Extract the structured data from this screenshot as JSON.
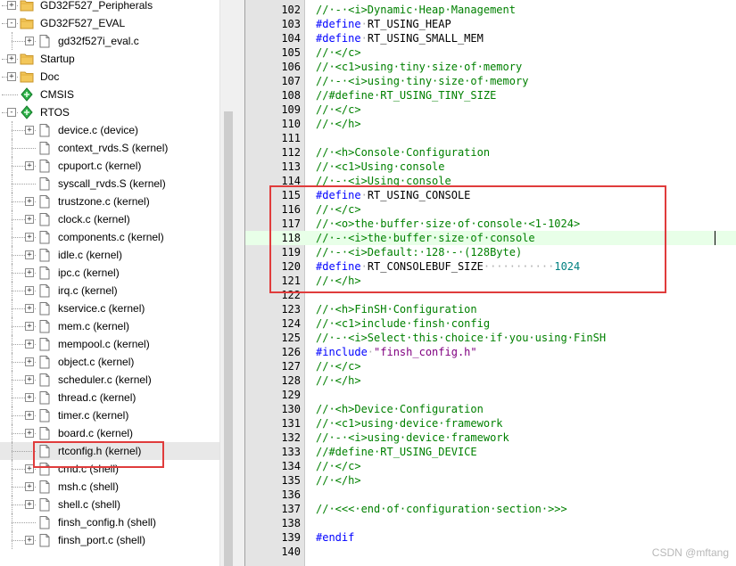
{
  "project_tree": {
    "items": [
      {
        "label": "GD32F527_Peripherals",
        "type": "folder",
        "state": "+",
        "level": 1
      },
      {
        "label": "GD32F527_EVAL",
        "type": "folder",
        "state": "-",
        "level": 1
      },
      {
        "label": "gd32f527i_eval.c",
        "type": "file",
        "state": "+",
        "level": 2
      },
      {
        "label": "Startup",
        "type": "folder",
        "state": "+",
        "level": 1
      },
      {
        "label": "Doc",
        "type": "folder",
        "state": "+",
        "level": 1
      },
      {
        "label": "CMSIS",
        "type": "component",
        "state": "",
        "level": 1
      },
      {
        "label": "RTOS",
        "type": "component",
        "state": "-",
        "level": 1
      },
      {
        "label": "device.c (device)",
        "type": "file",
        "state": "+",
        "level": 2
      },
      {
        "label": "context_rvds.S (kernel)",
        "type": "file",
        "state": "",
        "level": 2
      },
      {
        "label": "cpuport.c (kernel)",
        "type": "file",
        "state": "+",
        "level": 2
      },
      {
        "label": "syscall_rvds.S (kernel)",
        "type": "file",
        "state": "",
        "level": 2
      },
      {
        "label": "trustzone.c (kernel)",
        "type": "file",
        "state": "+",
        "level": 2
      },
      {
        "label": "clock.c (kernel)",
        "type": "file",
        "state": "+",
        "level": 2
      },
      {
        "label": "components.c (kernel)",
        "type": "file",
        "state": "+",
        "level": 2
      },
      {
        "label": "idle.c (kernel)",
        "type": "file",
        "state": "+",
        "level": 2
      },
      {
        "label": "ipc.c (kernel)",
        "type": "file",
        "state": "+",
        "level": 2
      },
      {
        "label": "irq.c (kernel)",
        "type": "file",
        "state": "+",
        "level": 2
      },
      {
        "label": "kservice.c (kernel)",
        "type": "file",
        "state": "+",
        "level": 2
      },
      {
        "label": "mem.c (kernel)",
        "type": "file",
        "state": "+",
        "level": 2
      },
      {
        "label": "mempool.c (kernel)",
        "type": "file",
        "state": "+",
        "level": 2
      },
      {
        "label": "object.c (kernel)",
        "type": "file",
        "state": "+",
        "level": 2
      },
      {
        "label": "scheduler.c (kernel)",
        "type": "file",
        "state": "+",
        "level": 2
      },
      {
        "label": "thread.c (kernel)",
        "type": "file",
        "state": "+",
        "level": 2
      },
      {
        "label": "timer.c (kernel)",
        "type": "file",
        "state": "+",
        "level": 2
      },
      {
        "label": "board.c (kernel)",
        "type": "file",
        "state": "+",
        "level": 2
      },
      {
        "label": "rtconfig.h (kernel)",
        "type": "file",
        "state": "",
        "level": 2,
        "selected": true
      },
      {
        "label": "cmd.c (shell)",
        "type": "file",
        "state": "+",
        "level": 2
      },
      {
        "label": "msh.c (shell)",
        "type": "file",
        "state": "+",
        "level": 2
      },
      {
        "label": "shell.c (shell)",
        "type": "file",
        "state": "+",
        "level": 2
      },
      {
        "label": "finsh_config.h (shell)",
        "type": "file",
        "state": "",
        "level": 2
      },
      {
        "label": "finsh_port.c (shell)",
        "type": "file",
        "state": "+",
        "level": 2
      }
    ]
  },
  "editor": {
    "current_line": 118,
    "lines": [
      {
        "n": "102",
        "tokens": [
          [
            "cm",
            "//·-·<i>Dynamic·Heap·Management"
          ]
        ]
      },
      {
        "n": "103",
        "tokens": [
          [
            "pp",
            "#define"
          ],
          [
            "ws",
            "·"
          ],
          [
            "pl",
            "RT_USING_HEAP"
          ]
        ]
      },
      {
        "n": "104",
        "tokens": [
          [
            "pp",
            "#define"
          ],
          [
            "ws",
            "·"
          ],
          [
            "pl",
            "RT_USING_SMALL_MEM"
          ]
        ]
      },
      {
        "n": "105",
        "tokens": [
          [
            "cm",
            "//·</c>"
          ]
        ]
      },
      {
        "n": "106",
        "tokens": [
          [
            "cm",
            "//·<c1>using·tiny·size·of·memory"
          ]
        ]
      },
      {
        "n": "107",
        "tokens": [
          [
            "cm",
            "//·-·<i>using·tiny·size·of·memory"
          ]
        ]
      },
      {
        "n": "108",
        "tokens": [
          [
            "cm",
            "//#define·RT_USING_TINY_SIZE"
          ]
        ]
      },
      {
        "n": "109",
        "tokens": [
          [
            "cm",
            "//·</c>"
          ]
        ]
      },
      {
        "n": "110",
        "tokens": [
          [
            "cm",
            "//·</h>"
          ]
        ]
      },
      {
        "n": "111",
        "tokens": []
      },
      {
        "n": "112",
        "tokens": [
          [
            "cm",
            "//·<h>Console·Configuration"
          ]
        ]
      },
      {
        "n": "113",
        "tokens": [
          [
            "cm",
            "//·<c1>Using·console"
          ]
        ]
      },
      {
        "n": "114",
        "tokens": [
          [
            "cm",
            "//·-·<i>Using·console"
          ]
        ]
      },
      {
        "n": "115",
        "tokens": [
          [
            "pp",
            "#define"
          ],
          [
            "ws",
            "·"
          ],
          [
            "pl",
            "RT_USING_CONSOLE"
          ]
        ]
      },
      {
        "n": "116",
        "tokens": [
          [
            "cm",
            "//·</c>"
          ]
        ]
      },
      {
        "n": "117",
        "tokens": [
          [
            "cm",
            "//·<o>the·buffer·size·of·console·<1-1024>"
          ]
        ]
      },
      {
        "n": "118",
        "tokens": [
          [
            "cm",
            "//·-·<i>the·buffer·size·of·console"
          ]
        ]
      },
      {
        "n": "119",
        "tokens": [
          [
            "cm",
            "//·-·<i>Default:·128·-·(128Byte)"
          ]
        ]
      },
      {
        "n": "120",
        "tokens": [
          [
            "pp",
            "#define"
          ],
          [
            "ws",
            "·"
          ],
          [
            "pl",
            "RT_CONSOLEBUF_SIZE"
          ],
          [
            "ws",
            "···········"
          ],
          [
            "nm",
            "1024"
          ]
        ]
      },
      {
        "n": "121",
        "tokens": [
          [
            "cm",
            "//·</h>"
          ]
        ]
      },
      {
        "n": "122",
        "tokens": []
      },
      {
        "n": "123",
        "tokens": [
          [
            "cm",
            "//·<h>FinSH·Configuration"
          ]
        ]
      },
      {
        "n": "124",
        "tokens": [
          [
            "cm",
            "//·<c1>include·finsh·config"
          ]
        ]
      },
      {
        "n": "125",
        "tokens": [
          [
            "cm",
            "//·-·<i>Select·this·choice·if·you·using·FinSH"
          ]
        ]
      },
      {
        "n": "126",
        "tokens": [
          [
            "pp",
            "#include"
          ],
          [
            "ws",
            "·"
          ],
          [
            "st",
            "\"finsh_config.h\""
          ]
        ]
      },
      {
        "n": "127",
        "tokens": [
          [
            "cm",
            "//·</c>"
          ]
        ]
      },
      {
        "n": "128",
        "tokens": [
          [
            "cm",
            "//·</h>"
          ]
        ]
      },
      {
        "n": "129",
        "tokens": []
      },
      {
        "n": "130",
        "tokens": [
          [
            "cm",
            "//·<h>Device·Configuration"
          ]
        ]
      },
      {
        "n": "131",
        "tokens": [
          [
            "cm",
            "//·<c1>using·device·framework"
          ]
        ]
      },
      {
        "n": "132",
        "tokens": [
          [
            "cm",
            "//·-·<i>using·device·framework"
          ]
        ]
      },
      {
        "n": "133",
        "tokens": [
          [
            "cm",
            "//#define·RT_USING_DEVICE"
          ]
        ]
      },
      {
        "n": "134",
        "tokens": [
          [
            "cm",
            "//·</c>"
          ]
        ]
      },
      {
        "n": "135",
        "tokens": [
          [
            "cm",
            "//·</h>"
          ]
        ]
      },
      {
        "n": "136",
        "tokens": []
      },
      {
        "n": "137",
        "tokens": [
          [
            "cm",
            "//·<<<·end·of·configuration·section·>>>"
          ]
        ]
      },
      {
        "n": "138",
        "tokens": []
      },
      {
        "n": "139",
        "tokens": [
          [
            "pp",
            "#endif"
          ]
        ]
      },
      {
        "n": "140",
        "tokens": []
      }
    ]
  },
  "annotations": {
    "highlight_color": "#e03c3c"
  },
  "watermark": "CSDN @mftang"
}
